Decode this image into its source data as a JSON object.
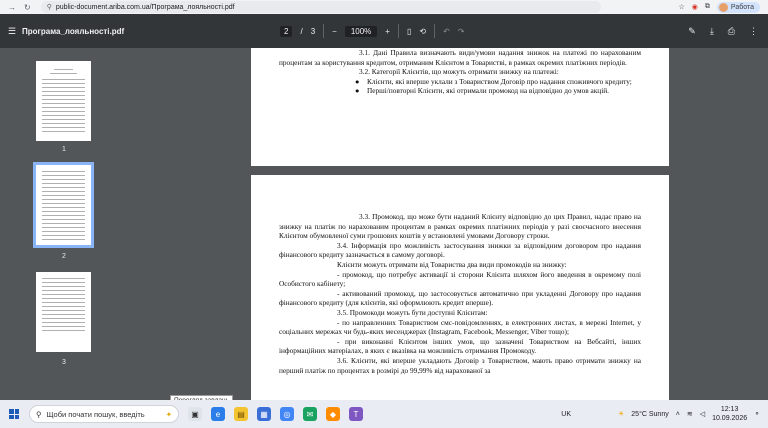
{
  "browser": {
    "url": "public-document.ariba.com.ua/Програма_лояльності.pdf",
    "profile_label": "Работа"
  },
  "pdf_toolbar": {
    "file_name": "Програма_лояльності.pdf",
    "current_page": "2",
    "page_separator": "/",
    "total_pages": "3",
    "zoom": "100%",
    "zoom_minus": "−",
    "zoom_plus": "+"
  },
  "thumbnails": [
    {
      "label": "1"
    },
    {
      "label": "2"
    },
    {
      "label": "3"
    }
  ],
  "page1_text": [
    "3.1. Дані Правила визначають види/умови надання знижок на платежі по нарахованим процентам за користування кредитом, отриманим Клієнтом в Товаристві, в рамках окремих платіжних періодів.",
    "3.2. Категорії Клієнтів, що можуть отримати знижку на платежі:",
    "Клієнти, які вперше уклали з Товариством Договір про надання споживчого кредиту;",
    "Перші/повторні Клієнти, які отримали промокод на відповідно до умов акцій."
  ],
  "page2_text": [
    "3.3. Промокод, що може бути наданий Клієнту відповідно до цих Правил, надає право на знижку на платіж по нарахованим процентам в рамках окремих платіжних періодів у разі своєчасного внесення Клієнтом обумовленої суми грошових коштів у встановлені умовами Договору строки.",
    "3.4. Інформація про можливість застосування знижки за відповідним договором про надання фінансового кредиту зазначається в самому договорі.",
    "Клієнти можуть отримати від Товариства два види промокодів на знижку:",
    "- промокод, що потребує активації зі сторони Клієнта шляхом його введення в окремому полі Особистого кабінету;",
    "- активований промокод, що застосовується автоматично при укладенні Договору про надання фінансового кредиту (для клієнтів, які оформлюють кредит вперше).",
    "3.5. Промокоди можуть бути доступні Клієнтам:",
    "- по направленних Товариством смс-повідомленнях, в електронних листах, в мережі Internet, у соціальних мережах чи будь-яких месенджерах (Instagram, Facebook, Messenger, Viber тощо);",
    "- при виконанні Клієнтом інших умов, що зазначені Товариством на Вебсайті, інших інформаційних матеріалах, в яких є вказівка на можливість отримання Промокоду.",
    "3.6. Клієнти, які вперше укладають Договір з Товариством, мають право отримати знижку на перший платіж по процентах в розмірі до 99,99% від нарахованої за"
  ],
  "taskbar": {
    "search_placeholder": "Щоби почати пошук, введіть",
    "tooltip": "Перегляд завдань",
    "language": "UK",
    "weather": "25°C  Sunny",
    "time": "12:13",
    "date": "10.09.2026"
  },
  "colors": {
    "toolbar_bg": "#323639",
    "viewer_bg": "#525659",
    "selected_thumb": "#8ab4f8"
  }
}
